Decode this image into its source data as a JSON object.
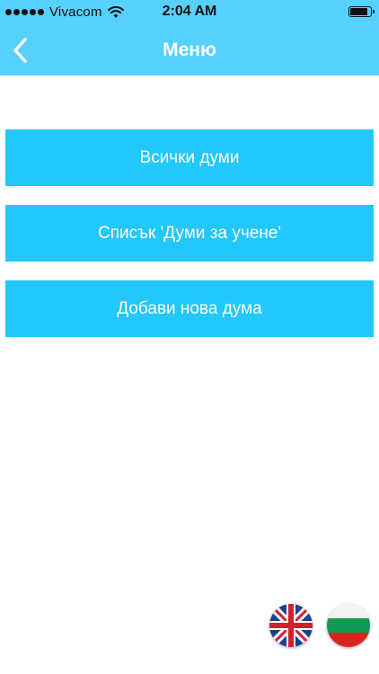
{
  "status_bar": {
    "carrier": "Vivacom",
    "time": "2:04 AM",
    "icons": [
      "signal-dots-icon",
      "wifi-icon",
      "battery-icon"
    ]
  },
  "nav": {
    "title": "Меню",
    "back_icon": "chevron-left-icon"
  },
  "menu": {
    "items": [
      {
        "label": "Всички думи"
      },
      {
        "label": "Списък 'Думи за учене'"
      },
      {
        "label": "Добави нова дума"
      }
    ]
  },
  "languages": {
    "options": [
      "uk-flag-icon",
      "bulgaria-flag-icon"
    ]
  },
  "colors": {
    "header": "#56d1fb",
    "button": "#22c7fc",
    "button_text": "#ffffff",
    "background": "#ffffff"
  }
}
